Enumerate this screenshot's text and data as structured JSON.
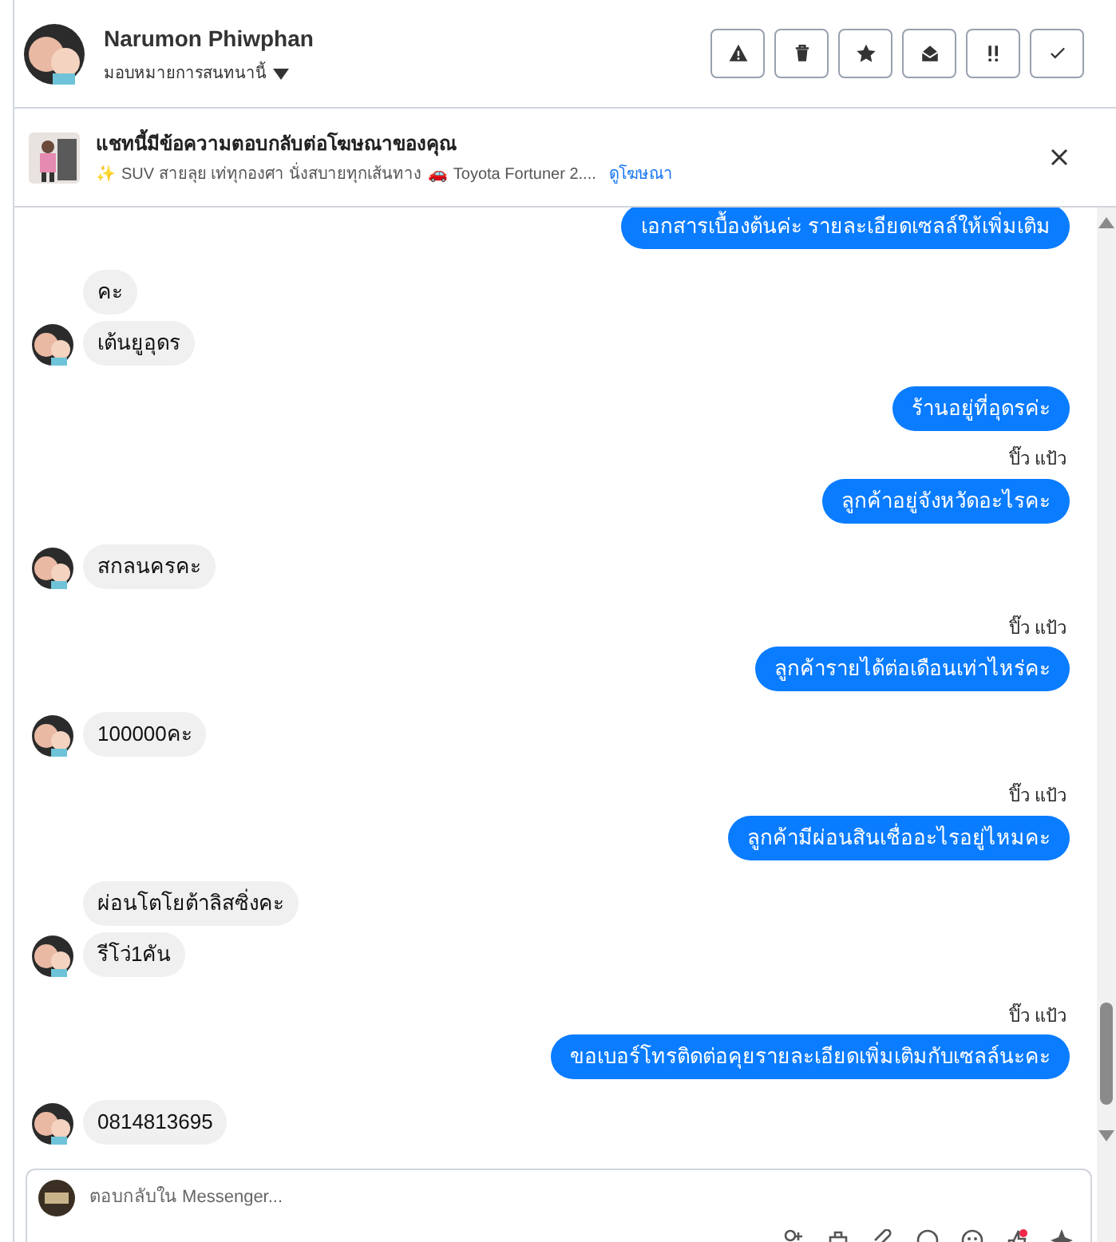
{
  "header": {
    "name": "Narumon Phiwphan",
    "assign": "มอบหมายการสนทนานี้",
    "actions": [
      {
        "kind": "spam"
      },
      {
        "kind": "delete"
      },
      {
        "kind": "star"
      },
      {
        "kind": "read"
      },
      {
        "kind": "important"
      },
      {
        "kind": "done"
      }
    ]
  },
  "ad_banner": {
    "title": "แชทนี้มีข้อความตอบกลับต่อโฆษณาของคุณ",
    "sparkle": "✨",
    "description_1": "SUV สายลุย เท่ทุกองศา นั่งสบายทุกเส้นทาง",
    "car": "🚗",
    "description_2": "Toyota Fortuner 2....",
    "link": "ดูโฆษณา"
  },
  "messages": [
    {
      "kind": "outgoing",
      "text": "เอกสารเบื้องต้นค่ะ รายละเอียดเซลล์ให้เพิ่มเติม"
    },
    {
      "kind": "incoming",
      "text": "คะ",
      "avatar": false
    },
    {
      "kind": "incoming",
      "text": "เต้นยูอุดร",
      "avatar": true
    },
    {
      "kind": "outgoing",
      "text": "ร้านอยู่ที่อุดรค่ะ"
    },
    {
      "kind": "sender",
      "text": "ปิ๊ว แป้ว"
    },
    {
      "kind": "outgoing",
      "text": "ลูกค้าอยู่จังหวัดอะไรคะ"
    },
    {
      "kind": "incoming",
      "text": "สกลนครคะ",
      "avatar": true
    },
    {
      "kind": "sender",
      "text": "ปิ๊ว แป้ว"
    },
    {
      "kind": "outgoing",
      "text": "ลูกค้ารายได้ต่อเดือนเท่าไหร่คะ"
    },
    {
      "kind": "incoming",
      "text": "100000คะ",
      "avatar": true
    },
    {
      "kind": "sender",
      "text": "ปิ๊ว แป้ว"
    },
    {
      "kind": "outgoing",
      "text": "ลูกค้ามีผ่อนสินเชื่ออะไรอยู่ไหมคะ"
    },
    {
      "kind": "incoming",
      "text": "ผ่อนโตโยต้าลิสซิ่งคะ",
      "avatar": false
    },
    {
      "kind": "incoming",
      "text": "รีโว่1คัน",
      "avatar": true
    },
    {
      "kind": "sender",
      "text": "ปิ๊ว แป้ว"
    },
    {
      "kind": "outgoing",
      "text": "ขอเบอร์โทรติดต่อคุยรายละเอียดเพิ่มเติมกับเซลล์นะคะ"
    },
    {
      "kind": "incoming",
      "text": "0814813695",
      "avatar": true
    }
  ],
  "composer": {
    "placeholder": "ตอบกลับใน Messenger..."
  }
}
